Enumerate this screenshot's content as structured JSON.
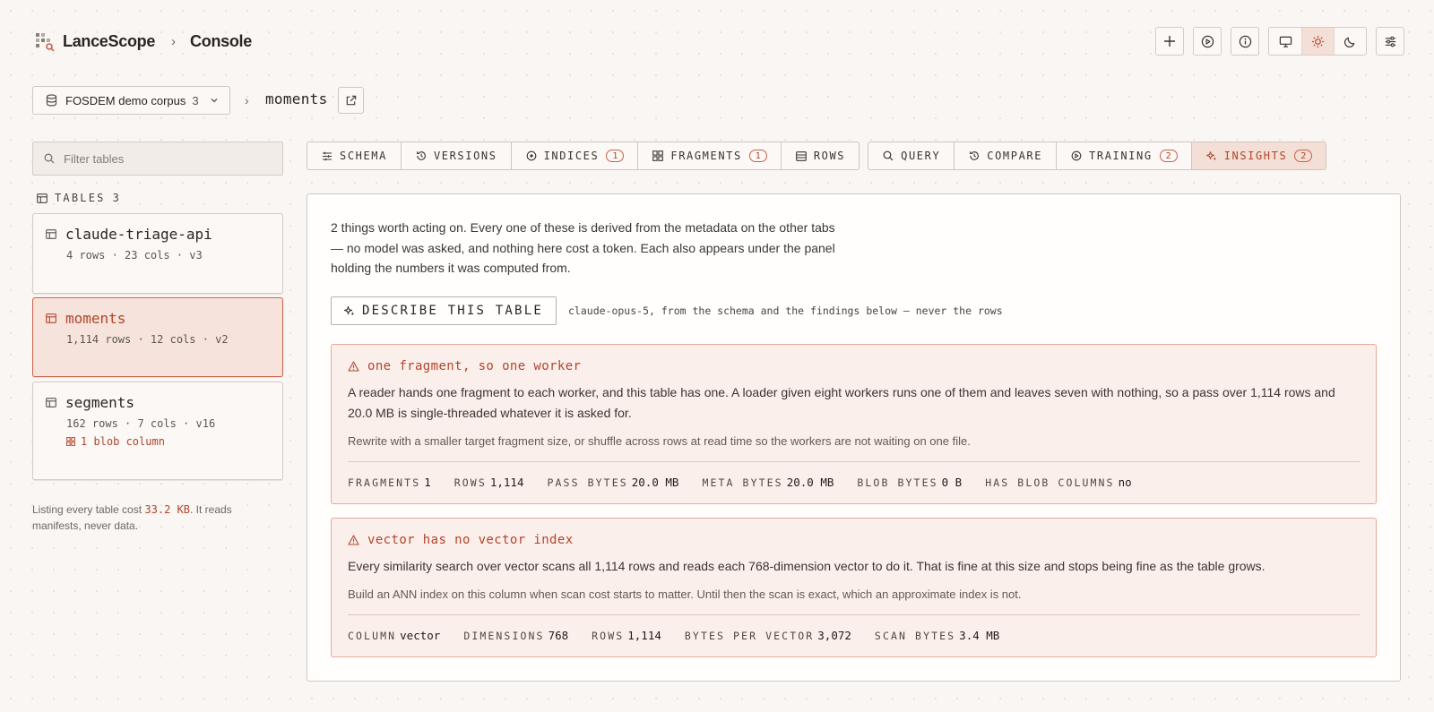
{
  "app": {
    "brand": "LanceScope",
    "breadcrumb_sep": "›",
    "page": "Console"
  },
  "header_actions": [
    "plus-icon",
    "play-circle-icon",
    "info-icon",
    "monitor-icon",
    "sun-icon",
    "moon-icon",
    "sliders-icon"
  ],
  "theme": {
    "selected": "light"
  },
  "project": {
    "name": "FOSDEM demo corpus",
    "count": "3",
    "sep": "›",
    "current_table": "moments"
  },
  "sidebar": {
    "filter_placeholder": "Filter tables",
    "tables_label": "TABLES",
    "tables_count": "3",
    "tables": [
      {
        "name": "claude-triage-api",
        "meta": "4 rows · 23 cols · v3",
        "blob": "",
        "active": false
      },
      {
        "name": "moments",
        "meta": "1,114 rows · 12 cols · v2",
        "blob": "",
        "active": true
      },
      {
        "name": "segments",
        "meta": "162 rows · 7 cols · v16",
        "blob": "1 blob column",
        "active": false
      }
    ],
    "note_prefix": "Listing every table cost ",
    "note_value": "33.2 KB",
    "note_suffix": ". It reads manifests, never data."
  },
  "tabs": {
    "group1": [
      {
        "label": "SCHEMA",
        "icon": "list-icon",
        "badge": ""
      },
      {
        "label": "VERSIONS",
        "icon": "history-icon",
        "badge": ""
      },
      {
        "label": "INDICES",
        "icon": "target-icon",
        "badge": "1"
      },
      {
        "label": "FRAGMENTS",
        "icon": "grid-icon",
        "badge": "1"
      },
      {
        "label": "ROWS",
        "icon": "rows-icon",
        "badge": ""
      }
    ],
    "group2": [
      {
        "label": "QUERY",
        "icon": "search-icon",
        "badge": ""
      },
      {
        "label": "COMPARE",
        "icon": "history-icon",
        "badge": ""
      },
      {
        "label": "TRAINING",
        "icon": "play-circle-icon",
        "badge": "2"
      },
      {
        "label": "INSIGHTS",
        "icon": "sparkle-icon",
        "badge": "2",
        "active": true
      }
    ]
  },
  "insights": {
    "intro": "2 things worth acting on. Every one of these is derived from the metadata on the other tabs — no model was asked, and nothing here cost a token. Each also appears under the panel holding the numbers it was computed from.",
    "describe_label": "DESCRIBE THIS TABLE",
    "describe_note": "claude-opus-5, from the schema and the findings below — never the rows",
    "findings": [
      {
        "title": "one fragment, so one worker",
        "body": "A reader hands one fragment to each worker, and this table has one. A loader given eight workers runs one of them and leaves seven with nothing, so a pass over 1,114 rows and 20.0 MB is single-threaded whatever it is asked for.",
        "advice": "Rewrite with a smaller target fragment size, or shuffle across rows at read time so the workers are not waiting on one file.",
        "metrics": [
          {
            "label": "FRAGMENTS",
            "value": "1"
          },
          {
            "label": "ROWS",
            "value": "1,114"
          },
          {
            "label": "PASS BYTES",
            "value": "20.0 MB"
          },
          {
            "label": "META BYTES",
            "value": "20.0 MB"
          },
          {
            "label": "BLOB BYTES",
            "value": "0 B"
          },
          {
            "label": "HAS BLOB COLUMNS",
            "value": "no"
          }
        ]
      },
      {
        "title": "vector has no vector index",
        "body": "Every similarity search over vector scans all 1,114 rows and reads each 768-dimension vector to do it. That is fine at this size and stops being fine as the table grows.",
        "advice": "Build an ANN index on this column when scan cost starts to matter. Until then the scan is exact, which an approximate index is not.",
        "metrics": [
          {
            "label": "COLUMN",
            "value": "vector"
          },
          {
            "label": "DIMENSIONS",
            "value": "768"
          },
          {
            "label": "ROWS",
            "value": "1,114"
          },
          {
            "label": "BYTES PER VECTOR",
            "value": "3,072"
          },
          {
            "label": "SCAN BYTES",
            "value": "3.4 MB"
          }
        ]
      }
    ]
  },
  "colors": {
    "accent": "#b2452a",
    "accent_bg": "#f3dfd6",
    "finding_bg": "#fbefeb",
    "finding_border": "#e6a898",
    "page_bg": "#faf6f3"
  }
}
